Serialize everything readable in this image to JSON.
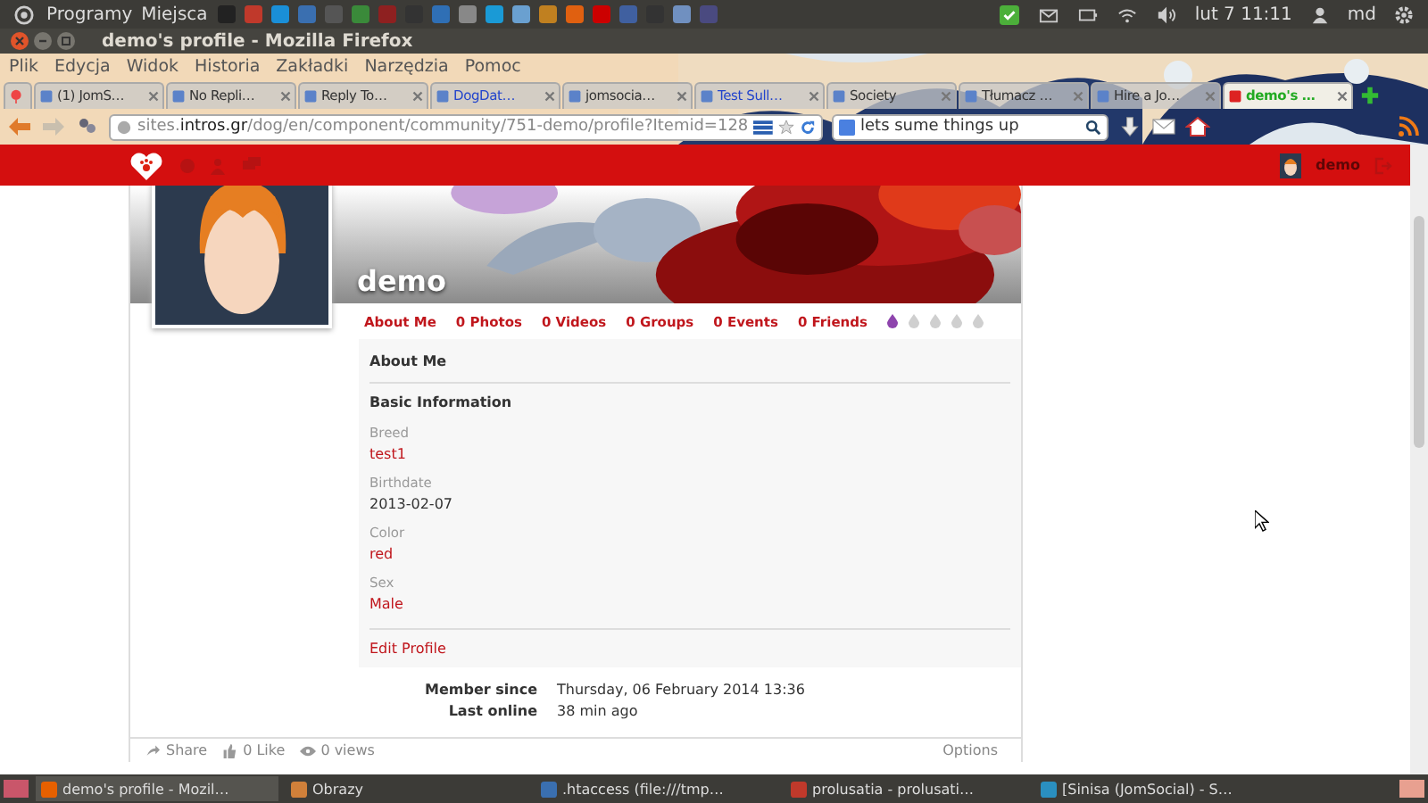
{
  "top_panel": {
    "menus": [
      "Programy",
      "Miejsca"
    ],
    "clock": "lut 7 11:11",
    "user": "md"
  },
  "window": {
    "title": "demo's profile - Mozilla Firefox"
  },
  "menu_bar": [
    "Plik",
    "Edycja",
    "Widok",
    "Historia",
    "Zakładki",
    "Narzędzia",
    "Pomoc"
  ],
  "tabs": [
    {
      "label": "(1) JomS…",
      "selected": false,
      "color": "#333333"
    },
    {
      "label": "No Repli…",
      "selected": false,
      "color": "#333333"
    },
    {
      "label": "Reply To…",
      "selected": false,
      "color": "#333333"
    },
    {
      "label": "DogDat…",
      "selected": false,
      "color": "#2244cc"
    },
    {
      "label": "jomsocia…",
      "selected": false,
      "color": "#333333"
    },
    {
      "label": "Test Sull…",
      "selected": false,
      "color": "#2244cc"
    },
    {
      "label": "Society",
      "selected": false,
      "color": "#333333"
    },
    {
      "label": "Tłumacz …",
      "selected": false,
      "color": "#333333"
    },
    {
      "label": "Hire a Jo…",
      "selected": false,
      "color": "#333333"
    },
    {
      "label": "demo's …",
      "selected": true,
      "color": "#22aa22"
    }
  ],
  "address_bar": {
    "url": "sites.**intros.gr**/dog/en/component/community/751-demo/profile?Itemid=128"
  },
  "search_bar": {
    "value": "lets sume things up"
  },
  "site_toolbar": {
    "user": "demo"
  },
  "profile": {
    "name": "demo",
    "tabs": [
      "About Me",
      "0 Photos",
      "0 Videos",
      "0 Groups",
      "0 Events",
      "0 Friends"
    ],
    "stars": 1,
    "section_title": "About Me",
    "group_title": "Basic Information",
    "fields": [
      {
        "label": "Breed",
        "value": "test1",
        "kind": "link"
      },
      {
        "label": "Birthdate",
        "value": "2013-02-07",
        "kind": "text"
      },
      {
        "label": "Color",
        "value": "red",
        "kind": "link"
      },
      {
        "label": "Sex",
        "value": "Male",
        "kind": "link"
      }
    ],
    "edit_link": "Edit Profile",
    "meta": [
      {
        "label": "Member since",
        "value": "Thursday, 06 February 2014 13:36"
      },
      {
        "label": "Last online",
        "value": "38 min ago"
      }
    ],
    "footer": {
      "share": "Share",
      "likes": "0 Like",
      "views": "0 views",
      "options": "Options"
    }
  },
  "taskbar": [
    "demo's profile - Mozil…",
    "Obrazy",
    ".htaccess (file:///tmp…",
    "prolusatia - prolusati…",
    "[Sinisa (JomSocial) - S…"
  ]
}
